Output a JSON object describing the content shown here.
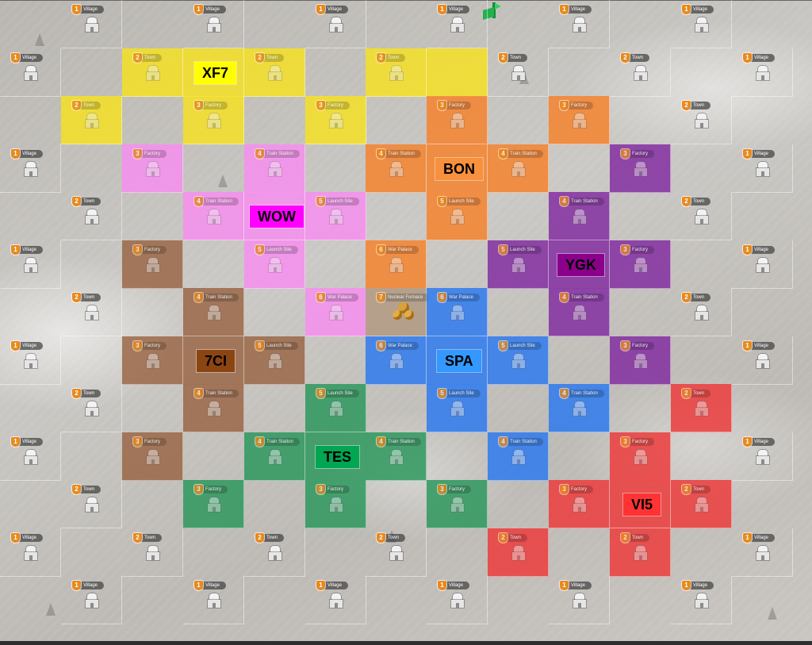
{
  "map": {
    "cols": 13,
    "rows": 13,
    "tiles": [
      {
        "level": "1",
        "name": "Village",
        "col": 1,
        "row": 0
      },
      {
        "level": "1",
        "name": "Village",
        "col": 3,
        "row": 0
      },
      {
        "level": "1",
        "name": "Village",
        "col": 5,
        "row": 0
      },
      {
        "level": "1",
        "name": "Village",
        "col": 7,
        "row": 0
      },
      {
        "level": "1",
        "name": "Village",
        "col": 9,
        "row": 0
      },
      {
        "level": "1",
        "name": "Village",
        "col": 11,
        "row": 0
      },
      {
        "level": "1",
        "name": "Village",
        "col": 0,
        "row": 1
      },
      {
        "level": "2",
        "name": "Town",
        "col": 2,
        "row": 1,
        "color": "yellow"
      },
      {
        "level": "",
        "name": "",
        "col": 3,
        "row": 1,
        "color": "yellow",
        "blank": true
      },
      {
        "level": "2",
        "name": "Town",
        "col": 4,
        "row": 1,
        "color": "yellow"
      },
      {
        "level": "2",
        "name": "Town",
        "col": 6,
        "row": 1,
        "color": "yellow"
      },
      {
        "level": "",
        "name": "",
        "col": 7,
        "row": 1,
        "color": "yellow",
        "blank": true
      },
      {
        "level": "2",
        "name": "Town",
        "col": 8,
        "row": 1
      },
      {
        "level": "2",
        "name": "Town",
        "col": 10,
        "row": 1
      },
      {
        "level": "1",
        "name": "Village",
        "col": 12,
        "row": 1
      },
      {
        "level": "2",
        "name": "Town",
        "col": 1,
        "row": 2,
        "color": "yellow"
      },
      {
        "level": "3",
        "name": "Factory",
        "col": 3,
        "row": 2,
        "color": "yellow"
      },
      {
        "level": "3",
        "name": "Factory",
        "col": 5,
        "row": 2,
        "color": "yellow"
      },
      {
        "level": "3",
        "name": "Factory",
        "col": 7,
        "row": 2,
        "color": "orange"
      },
      {
        "level": "3",
        "name": "Factory",
        "col": 9,
        "row": 2,
        "color": "orange"
      },
      {
        "level": "2",
        "name": "Town",
        "col": 11,
        "row": 2
      },
      {
        "level": "1",
        "name": "Village",
        "col": 0,
        "row": 3
      },
      {
        "level": "3",
        "name": "Factory",
        "col": 2,
        "row": 3,
        "color": "pink"
      },
      {
        "level": "4",
        "name": "Train Station",
        "col": 4,
        "row": 3,
        "color": "pink"
      },
      {
        "level": "4",
        "name": "Train Station",
        "col": 6,
        "row": 3,
        "color": "orange"
      },
      {
        "level": "",
        "name": "",
        "col": 7,
        "row": 3,
        "color": "orange",
        "blank": true
      },
      {
        "level": "4",
        "name": "Train Station",
        "col": 8,
        "row": 3,
        "color": "orange"
      },
      {
        "level": "3",
        "name": "Factory",
        "col": 10,
        "row": 3,
        "color": "purple"
      },
      {
        "level": "1",
        "name": "Village",
        "col": 12,
        "row": 3
      },
      {
        "level": "2",
        "name": "Town",
        "col": 1,
        "row": 4
      },
      {
        "level": "4",
        "name": "Train Station",
        "col": 3,
        "row": 4,
        "color": "pink"
      },
      {
        "level": "",
        "name": "",
        "col": 4,
        "row": 4,
        "color": "pink",
        "blank": true
      },
      {
        "level": "5",
        "name": "Launch Site",
        "col": 5,
        "row": 4,
        "color": "pink"
      },
      {
        "level": "5",
        "name": "Launch Site",
        "col": 7,
        "row": 4,
        "color": "orange"
      },
      {
        "level": "4",
        "name": "Train Station",
        "col": 9,
        "row": 4,
        "color": "purple"
      },
      {
        "level": "2",
        "name": "Town",
        "col": 11,
        "row": 4
      },
      {
        "level": "1",
        "name": "Village",
        "col": 0,
        "row": 5
      },
      {
        "level": "3",
        "name": "Factory",
        "col": 2,
        "row": 5,
        "color": "brown"
      },
      {
        "level": "5",
        "name": "Launch Site",
        "col": 4,
        "row": 5,
        "color": "pink"
      },
      {
        "level": "6",
        "name": "War Palace",
        "col": 6,
        "row": 5,
        "color": "orange"
      },
      {
        "level": "5",
        "name": "Launch Site",
        "col": 8,
        "row": 5,
        "color": "purple"
      },
      {
        "level": "",
        "name": "",
        "col": 9,
        "row": 5,
        "color": "purple",
        "blank": true
      },
      {
        "level": "3",
        "name": "Factory",
        "col": 10,
        "row": 5,
        "color": "purple"
      },
      {
        "level": "1",
        "name": "Village",
        "col": 12,
        "row": 5
      },
      {
        "level": "2",
        "name": "Town",
        "col": 1,
        "row": 6
      },
      {
        "level": "4",
        "name": "Train Station",
        "col": 3,
        "row": 6,
        "color": "brown"
      },
      {
        "level": "6",
        "name": "War Palace",
        "col": 5,
        "row": 6,
        "color": "pink"
      },
      {
        "level": "7",
        "name": "Nuclear Furnace",
        "col": 6,
        "row": 6,
        "color": "tan",
        "furnace": true
      },
      {
        "level": "6",
        "name": "War Palace",
        "col": 7,
        "row": 6,
        "color": "blue"
      },
      {
        "level": "4",
        "name": "Train Station",
        "col": 9,
        "row": 6,
        "color": "purple"
      },
      {
        "level": "2",
        "name": "Town",
        "col": 11,
        "row": 6
      },
      {
        "level": "1",
        "name": "Village",
        "col": 0,
        "row": 7
      },
      {
        "level": "3",
        "name": "Factory",
        "col": 2,
        "row": 7,
        "color": "brown"
      },
      {
        "level": "",
        "name": "",
        "col": 3,
        "row": 7,
        "color": "brown",
        "blank": true
      },
      {
        "level": "5",
        "name": "Launch Site",
        "col": 4,
        "row": 7,
        "color": "brown"
      },
      {
        "level": "6",
        "name": "War Palace",
        "col": 6,
        "row": 7,
        "color": "blue"
      },
      {
        "level": "",
        "name": "",
        "col": 7,
        "row": 7,
        "color": "blue",
        "blank": true
      },
      {
        "level": "5",
        "name": "Launch Site",
        "col": 8,
        "row": 7,
        "color": "blue"
      },
      {
        "level": "3",
        "name": "Factory",
        "col": 10,
        "row": 7,
        "color": "purple"
      },
      {
        "level": "1",
        "name": "Village",
        "col": 12,
        "row": 7
      },
      {
        "level": "2",
        "name": "Town",
        "col": 1,
        "row": 8
      },
      {
        "level": "4",
        "name": "Train Station",
        "col": 3,
        "row": 8,
        "color": "brown"
      },
      {
        "level": "5",
        "name": "Launch Site",
        "col": 5,
        "row": 8,
        "color": "green"
      },
      {
        "level": "5",
        "name": "Launch Site",
        "col": 7,
        "row": 8,
        "color": "blue"
      },
      {
        "level": "4",
        "name": "Train Station",
        "col": 9,
        "row": 8,
        "color": "blue"
      },
      {
        "level": "2",
        "name": "Town",
        "col": 11,
        "row": 8,
        "color": "red"
      },
      {
        "level": "1",
        "name": "Village",
        "col": 0,
        "row": 9
      },
      {
        "level": "3",
        "name": "Factory",
        "col": 2,
        "row": 9,
        "color": "brown"
      },
      {
        "level": "4",
        "name": "Train Station",
        "col": 4,
        "row": 9,
        "color": "green"
      },
      {
        "level": "",
        "name": "",
        "col": 5,
        "row": 9,
        "color": "green",
        "blank": true
      },
      {
        "level": "4",
        "name": "Train Station",
        "col": 6,
        "row": 9,
        "color": "green"
      },
      {
        "level": "4",
        "name": "Train Station",
        "col": 8,
        "row": 9,
        "color": "blue"
      },
      {
        "level": "3",
        "name": "Factory",
        "col": 10,
        "row": 9,
        "color": "red"
      },
      {
        "level": "1",
        "name": "Village",
        "col": 12,
        "row": 9
      },
      {
        "level": "2",
        "name": "Town",
        "col": 1,
        "row": 10
      },
      {
        "level": "3",
        "name": "Factory",
        "col": 3,
        "row": 10,
        "color": "green"
      },
      {
        "level": "3",
        "name": "Factory",
        "col": 5,
        "row": 10,
        "color": "green"
      },
      {
        "level": "3",
        "name": "Factory",
        "col": 7,
        "row": 10,
        "color": "green"
      },
      {
        "level": "3",
        "name": "Factory",
        "col": 9,
        "row": 10,
        "color": "red"
      },
      {
        "level": "",
        "name": "",
        "col": 10,
        "row": 10,
        "color": "red",
        "blank": true
      },
      {
        "level": "2",
        "name": "Town",
        "col": 11,
        "row": 10,
        "color": "red"
      },
      {
        "level": "1",
        "name": "Village",
        "col": 0,
        "row": 11
      },
      {
        "level": "2",
        "name": "Town",
        "col": 2,
        "row": 11
      },
      {
        "level": "2",
        "name": "Town",
        "col": 4,
        "row": 11
      },
      {
        "level": "2",
        "name": "Town",
        "col": 6,
        "row": 11
      },
      {
        "level": "2",
        "name": "Town",
        "col": 8,
        "row": 11,
        "color": "red"
      },
      {
        "level": "2",
        "name": "Town",
        "col": 10,
        "row": 11,
        "color": "red"
      },
      {
        "level": "1",
        "name": "Village",
        "col": 12,
        "row": 11
      },
      {
        "level": "1",
        "name": "Village",
        "col": 1,
        "row": 12
      },
      {
        "level": "1",
        "name": "Village",
        "col": 3,
        "row": 12
      },
      {
        "level": "1",
        "name": "Village",
        "col": 5,
        "row": 12
      },
      {
        "level": "1",
        "name": "Village",
        "col": 7,
        "row": 12
      },
      {
        "level": "1",
        "name": "Village",
        "col": 9,
        "row": 12
      },
      {
        "level": "1",
        "name": "Village",
        "col": 11,
        "row": 12
      }
    ]
  },
  "alliances": [
    {
      "label": "XF7",
      "col": 3,
      "row": 1,
      "bg": "#ffff00",
      "fg": "#000000"
    },
    {
      "label": "BON",
      "col": 7,
      "row": 3,
      "bg": "#f7913d",
      "fg": "#000000"
    },
    {
      "label": "WOW",
      "col": 4,
      "row": 4,
      "bg": "#ff00ff",
      "fg": "#000000"
    },
    {
      "label": "YGK",
      "col": 9,
      "row": 5,
      "bg": "#8b008b",
      "fg": "#000000"
    },
    {
      "label": "7CI",
      "col": 3,
      "row": 7,
      "bg": "#8b4513",
      "fg": "#000000"
    },
    {
      "label": "SPA",
      "col": 7,
      "row": 7,
      "bg": "#3399ff",
      "fg": "#000000"
    },
    {
      "label": "TES",
      "col": 5,
      "row": 9,
      "bg": "#00a651",
      "fg": "#000000"
    },
    {
      "label": "VI5",
      "col": 10,
      "row": 10,
      "bg": "#ff3333",
      "fg": "#000000"
    }
  ],
  "colors": {
    "yellow": "rgba(246,226,30,0.82)",
    "orange": "rgba(247,128,40,0.82)",
    "pink": "rgba(248,140,240,0.82)",
    "purple": "rgba(128,40,160,0.82)",
    "brown": "rgba(150,95,60,0.78)",
    "blue": "rgba(40,120,240,0.82)",
    "green": "rgba(40,150,90,0.82)",
    "red": "rgba(236,60,60,0.85)",
    "tan": "rgba(175,150,125,0.8)"
  }
}
